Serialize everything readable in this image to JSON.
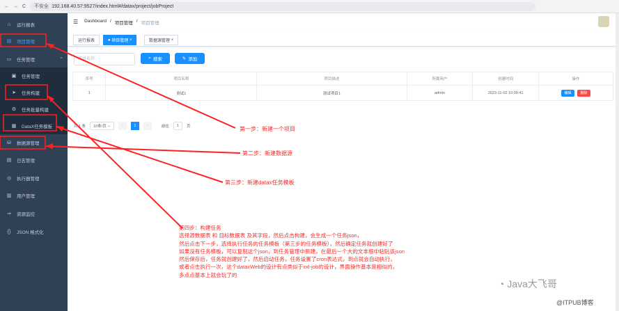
{
  "browser": {
    "insecure": "不安全",
    "url": "192.168.40.57:9527/index.html#/datax/project/jobProject"
  },
  "sidebar": {
    "items": [
      {
        "label": "运行报表",
        "icon": "home-icon"
      },
      {
        "label": "项目管理",
        "icon": "project-icon",
        "active": true
      },
      {
        "label": "任务管理",
        "icon": "monitor-icon"
      },
      {
        "label": "任务管理",
        "icon": "list-icon",
        "sub": true
      },
      {
        "label": "任务构建",
        "icon": "send-icon",
        "sub": true
      },
      {
        "label": "任务批量构建",
        "icon": "batch-icon",
        "sub": true
      },
      {
        "label": "DataX任务模板",
        "icon": "template-icon",
        "sub": true
      },
      {
        "label": "数据源管理",
        "icon": "database-icon"
      },
      {
        "label": "日志管理",
        "icon": "log-icon"
      },
      {
        "label": "执行器管理",
        "icon": "executor-icon"
      },
      {
        "label": "用户管理",
        "icon": "user-icon"
      },
      {
        "label": "资源监控",
        "icon": "monitor-resource-icon"
      },
      {
        "label": "JSON 格式化",
        "icon": "braces-icon"
      }
    ]
  },
  "breadcrumb": [
    "Dashboard",
    "项目管理",
    "项目管理"
  ],
  "tags": [
    "运行报表",
    "项目管理",
    "数据源管理"
  ],
  "search": {
    "placeholder": "项目名称",
    "search_label": "搜索",
    "add_label": "添加"
  },
  "table": {
    "headers": [
      "序号",
      "项目名称",
      "项目描述",
      "所属用户",
      "创建时间",
      "操作"
    ],
    "rows": [
      {
        "index": "1",
        "name": "测试1",
        "desc": "测试项目1",
        "user": "admin",
        "time": "2023-11-02 10:09:41",
        "edit": "编辑",
        "del": "删除"
      }
    ]
  },
  "pager": {
    "total": "共 1 条",
    "size": "10条/页",
    "page": "1",
    "goto": "前往",
    "goto_value": "1",
    "unit": "页"
  },
  "notes": {
    "step1": "第一步：新建一个项目",
    "step2": "第二步：新建数据源",
    "step3": "第三步：新建datax任务模板",
    "step4": [
      "第四步：构建任务",
      "选择源数据表 和  目标数据表 及其字段，然后点击构建，会生成一个任务json，",
      "然后点击下一步，选择执行任务的任务模板（第三步的任务模板），然后确定任务就创建好了",
      "如果没有任务模板，可以复制这个json，到任务管理中新建，在最后一个大的文本框中粘贴该json",
      "然后保存后，任务就创建好了，然后启动任务，任务设置了cron表达式，到点就会自动执行，",
      "或者点击执行一次，这个dataxWeb的设计有点类似于xxl-job的设计，界面操作基本是相似的，",
      "多点点基本上就会玩了的"
    ]
  },
  "watermark": {
    "line1": "Java大飞哥",
    "line2": "@ITPUB博客"
  }
}
